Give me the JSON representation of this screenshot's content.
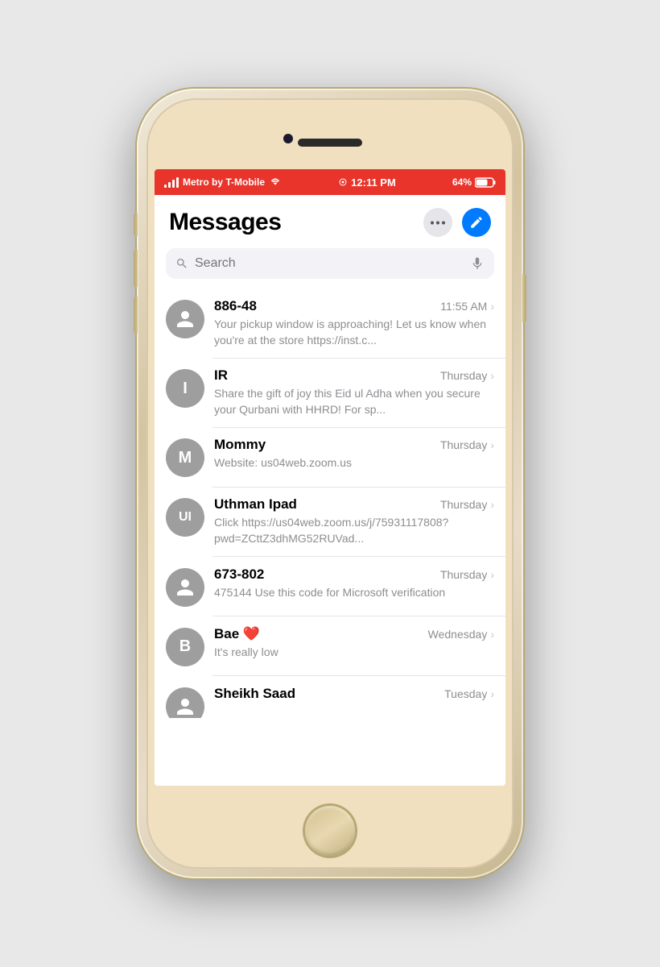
{
  "phone": {
    "status_bar": {
      "carrier": "Metro by T-Mobile",
      "wifi_icon": "wifi",
      "location_icon": "location",
      "time": "12:11 PM",
      "battery": "64%",
      "battery_icon": "battery"
    },
    "app": {
      "title": "Messages",
      "more_button_label": "···",
      "compose_button_label": "compose",
      "search_placeholder": "Search",
      "messages": [
        {
          "id": "886-48",
          "name": "886-48",
          "avatar_text": "",
          "avatar_type": "default",
          "avatar_color": "#9e9e9e",
          "time": "11:55 AM",
          "preview": "Your pickup window is approaching! Let us know when you're at the store https://inst.c..."
        },
        {
          "id": "IR",
          "name": "IR",
          "avatar_text": "I",
          "avatar_type": "letter",
          "avatar_color": "#9e9e9e",
          "time": "Thursday",
          "preview": "Share the gift of joy this Eid ul Adha when you secure your Qurbani with HHRD! For sp..."
        },
        {
          "id": "Mommy",
          "name": "Mommy",
          "avatar_text": "M",
          "avatar_type": "letter",
          "avatar_color": "#9e9e9e",
          "time": "Thursday",
          "preview": "Website: us04web.zoom.us"
        },
        {
          "id": "Uthman-Ipad",
          "name": "Uthman Ipad",
          "avatar_text": "UI",
          "avatar_type": "letter",
          "avatar_color": "#9e9e9e",
          "time": "Thursday",
          "preview": "Click https://us04web.zoom.us/j/75931117808?pwd=ZCttZ3dhMG52RUVad..."
        },
        {
          "id": "673-802",
          "name": "673-802",
          "avatar_text": "",
          "avatar_type": "default",
          "avatar_color": "#9e9e9e",
          "time": "Thursday",
          "preview": "475144\nUse this code for Microsoft verification"
        },
        {
          "id": "Bae",
          "name": "Bae ❤️",
          "avatar_text": "B",
          "avatar_type": "letter",
          "avatar_color": "#9e9e9e",
          "time": "Wednesday",
          "preview": "It's really low"
        },
        {
          "id": "Sheikh-Saad",
          "name": "Sheikh Saad",
          "avatar_text": "",
          "avatar_type": "default",
          "avatar_color": "#9e9e9e",
          "time": "Tuesday",
          "preview": ""
        }
      ]
    }
  }
}
